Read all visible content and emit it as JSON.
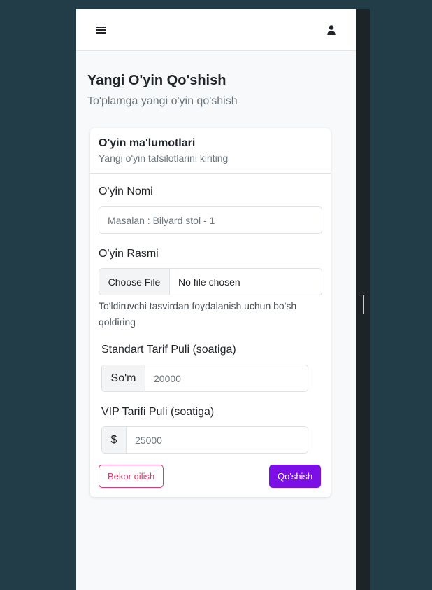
{
  "header": {
    "menu_icon": "hamburger-menu-icon",
    "user_icon": "user-profile-icon"
  },
  "page": {
    "title": "Yangi O'yin Qo'shish",
    "subtitle": "To'plamga yangi o'yin qo'shish"
  },
  "card": {
    "title": "O'yin ma'lumotlari",
    "subtitle": "Yangi o'yin tafsilotlarini kiriting"
  },
  "form": {
    "name_label": "O'yin Nomi",
    "name_placeholder": "Masalan : Bilyard stol - 1",
    "image_label": "O'yin Rasmi",
    "file_button": "Choose File",
    "file_status": "No file chosen",
    "image_help": "To'ldiruvchi tasvirdan foydalanish uchun bo'sh qoldiring",
    "standard_label": "Standart Tarif Puli (soatiga)",
    "standard_addon": "So'm",
    "standard_placeholder": "20000",
    "vip_label": "VIP Tarifi Puli (soatiga)",
    "vip_addon": "$",
    "vip_placeholder": "25000"
  },
  "actions": {
    "cancel": "Bekor qilish",
    "submit": "Qo'shish"
  },
  "colors": {
    "background": "#233d48",
    "accent": "#7b0fe6",
    "danger": "#dc3a6b"
  }
}
